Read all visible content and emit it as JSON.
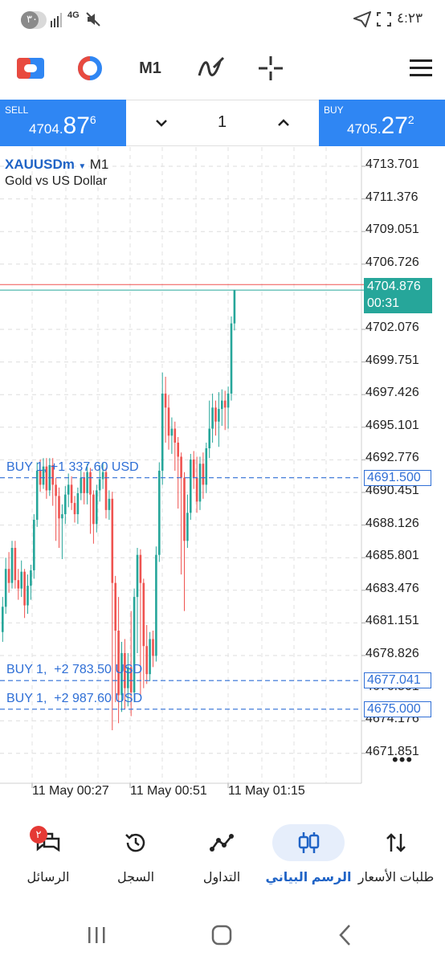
{
  "status_bar": {
    "time": "٤:٢٣",
    "battery": "٣٠",
    "network": "4G"
  },
  "toolbar": {
    "timeframe": "M1",
    "icons": [
      "trade-arrows-icon",
      "indicator-icon",
      "timeframe-button",
      "drawing-tools-icon",
      "crosshair-icon",
      "menu-icon"
    ]
  },
  "trade_bar": {
    "sell": {
      "label": "SELL",
      "price_prefix": "4704.",
      "price_big": "87",
      "price_sup": "6"
    },
    "buy": {
      "label": "BUY",
      "price_prefix": "4705.",
      "price_big": "27",
      "price_sup": "2"
    },
    "lot": "1"
  },
  "chart": {
    "symbol": "XAUUSDm",
    "timeframe": "M1",
    "description": "Gold vs US Dollar",
    "price_axis": [
      "4713.701",
      "4711.376",
      "4709.051",
      "4706.726",
      "4702.076",
      "4699.751",
      "4697.426",
      "4695.101",
      "4692.776",
      "4690.451",
      "4688.126",
      "4685.801",
      "4683.476",
      "4681.151",
      "4678.826",
      "4674.176",
      "4671.851"
    ],
    "current_bid": "4704.876",
    "countdown": "00:31",
    "ask_label": "4705.272",
    "time_axis": [
      "11 May 00:27",
      "11 May 00:51",
      "11 May 01:15"
    ],
    "positions": [
      {
        "label": "BUY 1, +1 337.60 USD",
        "price": "4691.500"
      },
      {
        "label": "BUY 1,  +2 783.50 USD",
        "price": "4677.041"
      },
      {
        "label": "BUY 1,  +2 987.60 USD",
        "price": "4675.000"
      }
    ],
    "hidden_axis_label": "4676.501",
    "colors": {
      "bull": "#26a69a",
      "bear": "#ef5350",
      "position_line": "#2f6fd6",
      "ask_line": "#ef5350"
    }
  },
  "bottom_nav": {
    "items": [
      {
        "label": "طلبات الأسعار",
        "icon": "quotes-icon"
      },
      {
        "label": "الرسم البياني",
        "icon": "chart-icon",
        "active": true
      },
      {
        "label": "التداول",
        "icon": "trade-icon"
      },
      {
        "label": "السجل",
        "icon": "history-icon"
      },
      {
        "label": "الرسائل",
        "icon": "messages-icon",
        "badge": "٢"
      }
    ]
  }
}
